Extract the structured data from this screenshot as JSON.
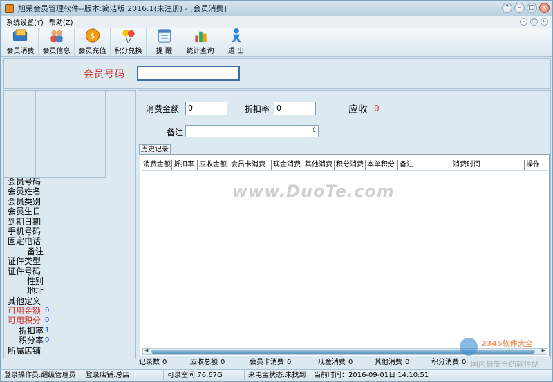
{
  "window": {
    "title": "旭荣会员管理软件--版本:简洁版 2016.1(未注册) - [会员消费]"
  },
  "menu": [
    "系统设置(Y)",
    "帮助(Z)"
  ],
  "toolbar": [
    {
      "label": "会员消费",
      "icon": "wallet-card-icon"
    },
    {
      "label": "会员信息",
      "icon": "members-icon"
    },
    {
      "label": "会员充值",
      "icon": "coin-icon"
    },
    {
      "label": "积分兑换",
      "icon": "balloons-icon"
    },
    {
      "label": "提 醒",
      "icon": "reminder-icon"
    },
    {
      "label": "统计查询",
      "icon": "stats-icon"
    },
    {
      "label": "退 出",
      "icon": "exit-person-icon"
    }
  ],
  "member_search": {
    "label": "会员号码",
    "value": ""
  },
  "member_info": [
    {
      "label": "会员号码",
      "value": "",
      "red": false,
      "align": "left"
    },
    {
      "label": "会员姓名",
      "value": "",
      "red": false,
      "align": "left"
    },
    {
      "label": "会员类别",
      "value": "",
      "red": false,
      "align": "left"
    },
    {
      "label": "会员生日",
      "value": "",
      "red": false,
      "align": "left"
    },
    {
      "label": "到期日期",
      "value": "",
      "red": false,
      "align": "left"
    },
    {
      "label": "手机号码",
      "value": "",
      "red": false,
      "align": "left"
    },
    {
      "label": "固定电话",
      "value": "",
      "red": false,
      "align": "left"
    },
    {
      "label": "备注",
      "value": "",
      "red": false,
      "align": "right"
    },
    {
      "label": "证件类型",
      "value": "",
      "red": false,
      "align": "left"
    },
    {
      "label": "证件号码",
      "value": "",
      "red": false,
      "align": "left"
    },
    {
      "label": "性别",
      "value": "",
      "red": false,
      "align": "right"
    },
    {
      "label": "地址",
      "value": "",
      "red": false,
      "align": "right"
    },
    {
      "label": "其他定义",
      "value": "",
      "red": false,
      "align": "left"
    },
    {
      "label": "可用金额",
      "value": "0",
      "red": true,
      "align": "left"
    },
    {
      "label": "可用积分",
      "value": "0",
      "red": true,
      "align": "left"
    },
    {
      "label": "折扣率",
      "value": "1",
      "red": false,
      "align": "right"
    },
    {
      "label": "积分率",
      "value": "0",
      "red": false,
      "align": "right"
    },
    {
      "label": "所属店铺",
      "value": "",
      "red": false,
      "align": "left"
    }
  ],
  "form": {
    "amount_label": "消费金额",
    "amount_value": "0",
    "discount_label": "折扣率",
    "discount_value": "0",
    "receivable_label": "应收",
    "receivable_value": "0",
    "note_label": "备注",
    "note_value": ""
  },
  "history": {
    "tab_label": "历史记录",
    "columns": [
      "消费金额",
      "折扣率",
      "应收金额",
      "会员卡消费",
      "现金消费",
      "其他消费",
      "积分消费",
      "本单积分",
      "备注",
      "消费时间",
      "操作"
    ]
  },
  "summary": [
    {
      "label": "记录数",
      "value": "0"
    },
    {
      "label": "应收总额",
      "value": "0"
    },
    {
      "label": "会员卡消费",
      "value": "0"
    },
    {
      "label": "现金消费",
      "value": "0"
    },
    {
      "label": "其他消费",
      "value": "0"
    },
    {
      "label": "积分消费",
      "value": "0"
    }
  ],
  "status": [
    "登录操作员:超级管理员",
    "登录店铺:总店",
    "可录空间:76.67G",
    "来电宝状态:未找到",
    "当前时间：2016-09-01日 14:10:51"
  ],
  "watermark": {
    "main": "www.DuoTe.com",
    "corner": "2345软件大全",
    "corner_sub": "国内最安全的软件站"
  }
}
